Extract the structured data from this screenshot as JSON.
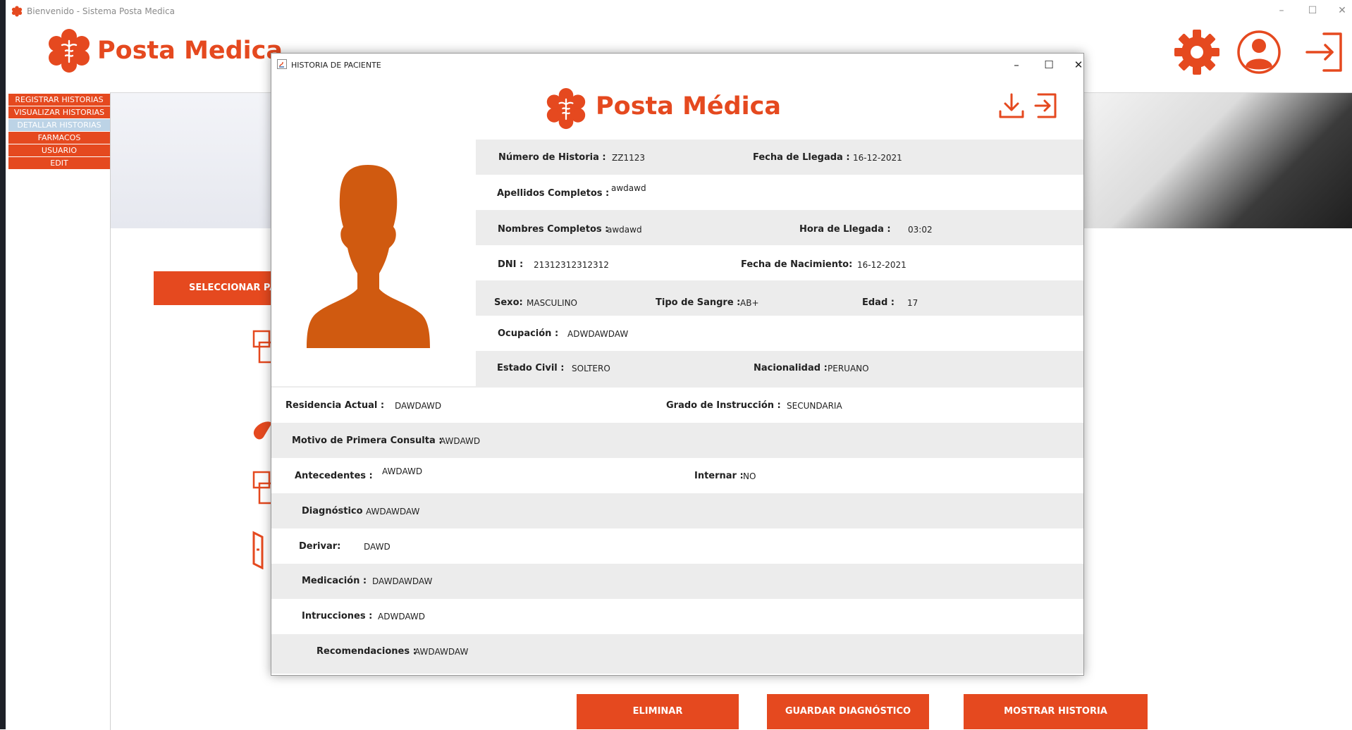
{
  "window": {
    "title": "Bienvenido - Sistema Posta Medica",
    "minimize": "–",
    "maximize": "☐",
    "close": "✕"
  },
  "brand": {
    "name": "Posta Medica"
  },
  "colors": {
    "accent": "#e5491f",
    "avatar": "#d05a10",
    "menu_active": "#bcd3e6",
    "row_gray": "#ececec"
  },
  "menu": {
    "items": [
      {
        "label": "REGISTRAR HISTORIAS"
      },
      {
        "label": "VISUALIZAR HISTORIAS"
      },
      {
        "label": "DETALLAR HISTORIAS"
      },
      {
        "label": "FARMACOS"
      },
      {
        "label": "USUARIO"
      },
      {
        "label": "EDIT"
      }
    ]
  },
  "content": {
    "select_button": "SELECCIONAR PA"
  },
  "bottom_buttons": {
    "delete": "ELIMINAR",
    "save_diagnosis": "GUARDAR DIAGNÓSTICO",
    "show_history": "MOSTRAR HISTORIA"
  },
  "dialog": {
    "title": "HISTORIA DE PACIENTE",
    "brand": "Posta Médica",
    "fields": {
      "numero_historia_label": "Número de Historia :",
      "numero_historia": "ZZ1123",
      "fecha_llegada_label": "Fecha de Llegada :",
      "fecha_llegada": "16-12-2021",
      "apellidos_label": "Apellidos Completos :",
      "apellidos": "awdawd",
      "nombres_label": "Nombres Completos :",
      "nombres": "awdawd",
      "hora_llegada_label": "Hora de Llegada :",
      "hora_llegada": "03:02",
      "dni_label": "DNI :",
      "dni": "21312312312312",
      "fecha_nacimiento_label": "Fecha de Nacimiento:",
      "fecha_nacimiento": "16-12-2021",
      "sexo_label": "Sexo:",
      "sexo": "MASCULINO",
      "tipo_sangre_label": "Tipo de Sangre :",
      "tipo_sangre": "AB+",
      "edad_label": "Edad :",
      "edad": "17",
      "ocupacion_label": "Ocupación :",
      "ocupacion": "ADWDAWDAW",
      "estado_civil_label": "Estado Civil :",
      "estado_civil": "SOLTERO",
      "nacionalidad_label": "Nacionalidad :",
      "nacionalidad": "PERUANO",
      "residencia_label": "Residencia Actual :",
      "residencia": "DAWDAWD",
      "grado_label": "Grado de Instrucción :",
      "grado": "SECUNDARIA",
      "motivo_label": "Motivo de Primera Consulta :",
      "motivo": "AWDAWD",
      "antecedentes_label": "Antecedentes :",
      "antecedentes": "AWDAWD",
      "internar_label": "Internar :",
      "internar": "NO",
      "diagnostico_label": "Diagnóstico",
      "diagnostico": "AWDAWDAW",
      "derivar_label": "Derivar:",
      "derivar": "DAWD",
      "medicacion_label": "Medicación :",
      "medicacion": "DAWDAWDAW",
      "intrucciones_label": "Intrucciones :",
      "intrucciones": "ADWDAWD",
      "recomendaciones_label": "Recomendaciones :",
      "recomendaciones": "AWDAWDAW"
    }
  }
}
